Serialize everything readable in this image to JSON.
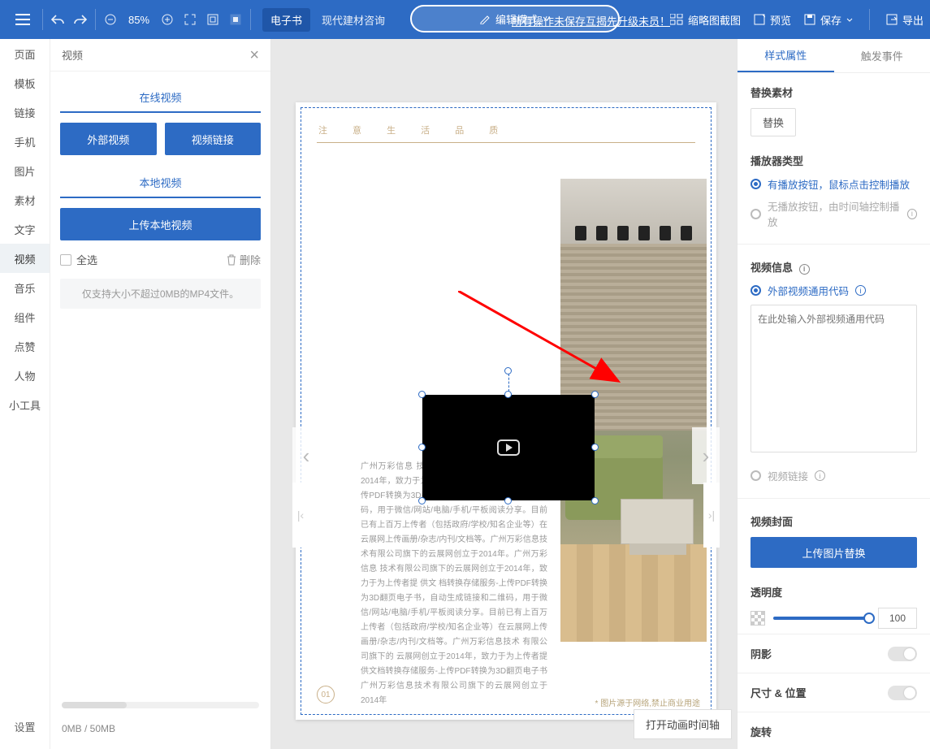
{
  "topbar": {
    "zoom": "85%",
    "ebook_tag": "电子书",
    "doc_title": "现代建材咨询",
    "edit_mode": "编辑模式",
    "save_hint": "所有操作未保存互揭先升级未员！",
    "thumb": "缩略图截图",
    "preview": "预览",
    "save": "保存",
    "export": "导出"
  },
  "leftnav": {
    "items": [
      "页面",
      "模板",
      "链接",
      "手机",
      "图片",
      "素材",
      "文字",
      "视频",
      "音乐",
      "组件",
      "点赞",
      "人物",
      "小工具"
    ],
    "settings": "设置"
  },
  "sidepanel": {
    "title": "视频",
    "tab_online": "在线视频",
    "btn_external": "外部视频",
    "btn_link": "视频链接",
    "tab_local": "本地视频",
    "btn_upload": "上传本地视频",
    "select_all": "全选",
    "delete": "删除",
    "note": "仅支持大小不超过0MB的MP4文件。",
    "storage": "0MB / 50MB"
  },
  "page": {
    "header": "注 意 生 活 品 质",
    "caption": "* 图片源于网络,禁止商业用途",
    "pgno": "01",
    "body": "广州万彩信息 技术有限公司旗下的云展网创立于2014年，致力于为上传者提供文档转换存储服务-上传PDF转换为3D翻页电子书，自动生成链接和二维码，用于微信/网站/电脑/手机/平板阅读分享。目前已有上百万上传者（包括政府/学校/知名企业等）在云展网上传画册/杂志/内刊/文档等。广州万彩信息技术有限公司旗下的云展网创立于2014年。广州万彩信息 技术有限公司旗下的云展网创立于2014年，致力于为上传者提 供文 档转换存储服务-上传PDF转换为3D翻页电子书，自动生成链接和二维码，用于微信/网站/电脑/手机/平板阅读分享。目前已有上百万上传者（包括政府/学校/知名企业等）在云展网上传画册/杂志/内刊/文档等。广州万彩信息技术 有限公司旗下的 云展网创立于2014年，致力于为上传者提供文档转换存储服务-上传PDF转换为3D翻页电子书广州万彩信息技术有限公司旗下的云展网创立于2014年"
  },
  "timeline_btn": "打开动画时间轴",
  "right": {
    "tab_style": "样式属性",
    "tab_event": "触发事件",
    "replace_title": "替换素材",
    "replace_btn": "替换",
    "player_title": "播放器类型",
    "player_opt1": "有播放按钮，鼠标点击控制播放",
    "player_opt2": "无播放按钮，由时间轴控制播放",
    "info_title": "视频信息",
    "code_opt": "外部视频通用代码",
    "ta_placeholder": "在此处输入外部视频通用代码",
    "link_opt": "视频链接",
    "cover_title": "视频封面",
    "cover_btn": "上传图片替换",
    "opacity_title": "透明度",
    "opacity_val": "100",
    "shadow": "阴影",
    "sizepos": "尺寸 & 位置",
    "rotate": "旋转"
  }
}
